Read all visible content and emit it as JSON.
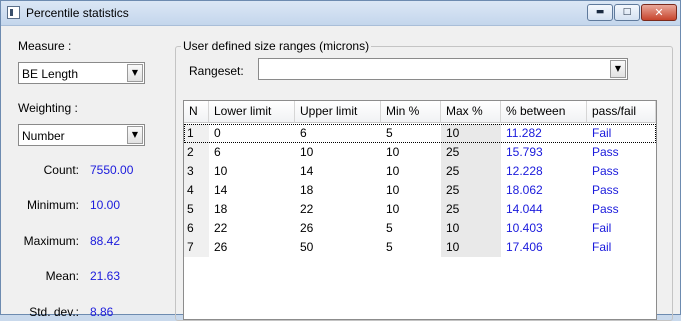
{
  "window": {
    "title": "Percentile statistics"
  },
  "left": {
    "measure_label": "Measure :",
    "measure_value": "BE Length",
    "weighting_label": "Weighting :",
    "weighting_value": "Number",
    "stats": [
      {
        "label": "Count:",
        "value": "7550.00"
      },
      {
        "label": "Minimum:",
        "value": "10.00"
      },
      {
        "label": "Maximum:",
        "value": "88.42"
      },
      {
        "label": "Mean:",
        "value": "21.63"
      },
      {
        "label": "Std. dev.:",
        "value": "8.86"
      }
    ]
  },
  "group": {
    "caption": "User defined size ranges (microns)",
    "rangeset_label": "Rangeset:",
    "rangeset_value": ""
  },
  "table": {
    "headers": [
      "N",
      "Lower limit",
      "Upper limit",
      "Min %",
      "Max %",
      "% between",
      "pass/fail"
    ],
    "rows": [
      [
        "1",
        "0",
        "6",
        "5",
        "10",
        "11.282",
        "Fail"
      ],
      [
        "2",
        "6",
        "10",
        "10",
        "25",
        "15.793",
        "Pass"
      ],
      [
        "3",
        "10",
        "14",
        "10",
        "25",
        "12.228",
        "Pass"
      ],
      [
        "4",
        "14",
        "18",
        "10",
        "25",
        "18.062",
        "Pass"
      ],
      [
        "5",
        "18",
        "22",
        "10",
        "25",
        "14.044",
        "Pass"
      ],
      [
        "6",
        "22",
        "26",
        "5",
        "10",
        "10.403",
        "Fail"
      ],
      [
        "7",
        "26",
        "50",
        "5",
        "10",
        "17.406",
        "Fail"
      ]
    ]
  },
  "colors": {
    "value_text": "#1a1adc",
    "shaded_column": "#e9e9e9"
  }
}
